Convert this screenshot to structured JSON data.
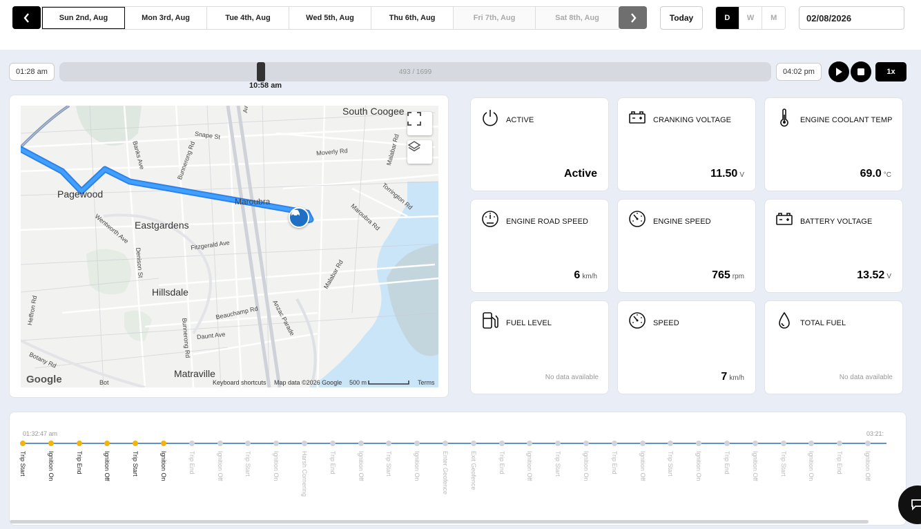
{
  "date_nav": {
    "days": [
      {
        "label": "Sun 2nd, Aug",
        "state": "active"
      },
      {
        "label": "Mon 3rd, Aug",
        "state": "normal"
      },
      {
        "label": "Tue 4th, Aug",
        "state": "normal"
      },
      {
        "label": "Wed 5th, Aug",
        "state": "normal"
      },
      {
        "label": "Thu 6th, Aug",
        "state": "normal"
      },
      {
        "label": "Fri 7th, Aug",
        "state": "disabled"
      },
      {
        "label": "Sat 8th, Aug",
        "state": "disabled"
      }
    ],
    "today_label": "Today",
    "periods": [
      "D",
      "W",
      "M"
    ],
    "selected_period": "D",
    "date_value": "02/08/2026"
  },
  "playback": {
    "start_time": "01:28 am",
    "end_time": "04:02 pm",
    "current_time": "10:58 am",
    "position_label": "493 / 1699",
    "position": 493,
    "total": 1699,
    "speed_label": "1x"
  },
  "map": {
    "places": [
      {
        "name": "South Coogee",
        "cls": "big"
      },
      {
        "name": "Pagewood",
        "cls": "big"
      },
      {
        "name": "Eastgardens",
        "cls": "big"
      },
      {
        "name": "Hillsdale",
        "cls": "big"
      },
      {
        "name": "Matraville",
        "cls": "big"
      },
      {
        "name": "Maroubra",
        "cls": "mid"
      }
    ],
    "streets": [
      "Snape St",
      "Moverly Rd",
      "Banks Ave",
      "Bunnerong Rd",
      "Malabar Rd",
      "Torrington Rd",
      "Maroubra Rd",
      "Wentworth Ave",
      "Fitzgerald Ave",
      "Denison St",
      "Anzac Parade",
      "Beauchamp Rd",
      "Daunt Ave",
      "Botany Rd",
      "Bunnerong Rd",
      "Malabar Rd",
      "Heffron Rd",
      "Ave",
      "Bot"
    ],
    "footer": {
      "logo": "Google",
      "shortcuts": "Keyboard shortcuts",
      "attribution": "Map data ©2026 Google",
      "scale": "500 m",
      "terms": "Terms"
    }
  },
  "metrics": [
    {
      "title": "ACTIVE",
      "icon": "power-icon",
      "value": "Active",
      "unit": ""
    },
    {
      "title": "CRANKING VOLTAGE",
      "icon": "battery-icon",
      "value": "11.50",
      "unit": "V"
    },
    {
      "title": "ENGINE COOLANT TEMP",
      "icon": "thermometer-icon",
      "value": "69.0",
      "unit": "°C"
    },
    {
      "title": "ENGINE ROAD SPEED",
      "icon": "gauge-icon",
      "value": "6",
      "unit": "km/h"
    },
    {
      "title": "ENGINE SPEED",
      "icon": "tachometer-icon",
      "value": "765",
      "unit": "rpm"
    },
    {
      "title": "BATTERY VOLTAGE",
      "icon": "battery-icon",
      "value": "13.52",
      "unit": "V"
    },
    {
      "title": "FUEL LEVEL",
      "icon": "fuel-pump-icon",
      "value": "",
      "unit": "",
      "nodata": "No data available"
    },
    {
      "title": "SPEED",
      "icon": "tachometer-icon",
      "value": "7",
      "unit": "km/h"
    },
    {
      "title": "TOTAL FUEL",
      "icon": "droplet-icon",
      "value": "",
      "unit": "",
      "nodata": "No data available"
    }
  ],
  "timeline": {
    "start_time": "01:32:47 am",
    "end_time": "03:21:",
    "events": [
      {
        "label": "Trip Start",
        "done": true
      },
      {
        "label": "Ignition On",
        "done": true
      },
      {
        "label": "Trip End",
        "done": true
      },
      {
        "label": "Ignition Off",
        "done": true
      },
      {
        "label": "Trip Start",
        "done": true
      },
      {
        "label": "Ignition On",
        "done": true
      },
      {
        "label": "Trip End",
        "done": false
      },
      {
        "label": "Ignition Off",
        "done": false
      },
      {
        "label": "Trip Start",
        "done": false
      },
      {
        "label": "Ignition On",
        "done": false
      },
      {
        "label": "Harsh Cornering",
        "done": false
      },
      {
        "label": "Trip End",
        "done": false
      },
      {
        "label": "Ignition Off",
        "done": false
      },
      {
        "label": "Trip Start",
        "done": false
      },
      {
        "label": "Ignition On",
        "done": false
      },
      {
        "label": "Enter Geofence",
        "done": false
      },
      {
        "label": "Exit Geofence",
        "done": false
      },
      {
        "label": "Trip End",
        "done": false
      },
      {
        "label": "Ignition Off",
        "done": false
      },
      {
        "label": "Trip Start",
        "done": false
      },
      {
        "label": "Ignition On",
        "done": false
      },
      {
        "label": "Trip End",
        "done": false
      },
      {
        "label": "Ignition Off",
        "done": false
      },
      {
        "label": "Trip Start",
        "done": false
      },
      {
        "label": "Ignition On",
        "done": false
      },
      {
        "label": "Trip End",
        "done": false
      },
      {
        "label": "Ignition Off",
        "done": false
      },
      {
        "label": "Trip Start",
        "done": false
      },
      {
        "label": "Ignition On",
        "done": false
      },
      {
        "label": "Trip End",
        "done": false
      },
      {
        "label": "Ignition Off",
        "done": false
      }
    ]
  },
  "colors": {
    "accent": "#000000",
    "route": "#2f8ff0",
    "timeline_line": "#5e8fcf",
    "event_done": "#f0b40c",
    "event_pending": "#cfd3da",
    "vehicle_marker": "#1f6fc4"
  }
}
